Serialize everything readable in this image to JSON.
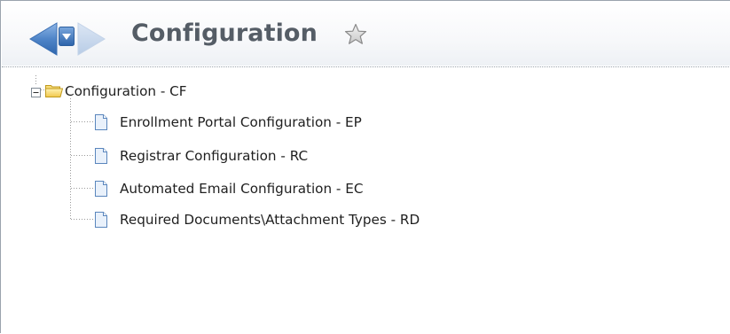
{
  "header": {
    "title": "Configuration",
    "icons": {
      "back": "arrow-left-icon",
      "menu": "dropdown-arrow-icon",
      "forward": "arrow-right-icon",
      "favorite": "star-icon"
    },
    "colors": {
      "arrow_blue": "#4f85c8",
      "title_gray": "#555d66"
    }
  },
  "tree": {
    "root": {
      "label": "Configuration - CF",
      "expanded": true,
      "icon": "folder-open-icon"
    },
    "children": [
      {
        "label": "Enrollment Portal Configuration - EP",
        "icon": "document-icon"
      },
      {
        "label": "Registrar Configuration - RC",
        "icon": "document-icon"
      },
      {
        "label": "Automated Email Configuration - EC",
        "icon": "document-icon"
      },
      {
        "label": "Required Documents\\Attachment Types - RD",
        "icon": "document-icon"
      }
    ]
  }
}
